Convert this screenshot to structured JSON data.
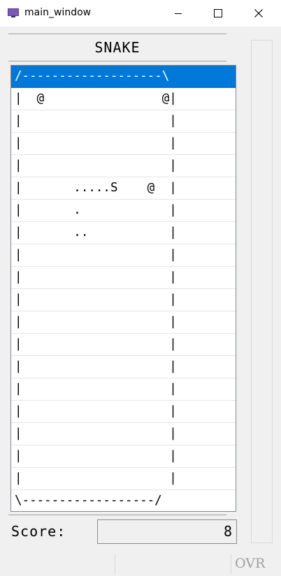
{
  "window": {
    "title": "main_window"
  },
  "game": {
    "title": "SNAKE",
    "board_rows": [
      "/-------------------\\",
      "|  @                @|",
      "|                    |",
      "|                    |",
      "|                    |",
      "|       .....S    @  |",
      "|       .            |",
      "|       ..           |",
      "|                    |",
      "|                    |",
      "|                    |",
      "|                    |",
      "|                    |",
      "|                    |",
      "|                    |",
      "|                    |",
      "|                    |",
      "|                    |",
      "|                    |",
      "\\------------------/"
    ],
    "score_label": "Score:",
    "score_value": "8"
  },
  "statusbar": {
    "mode": "OVR"
  },
  "colors": {
    "selection": "#0078d7",
    "background": "#f0f0f0"
  },
  "icons": {
    "app": "app-window-icon",
    "minimize": "minimize-icon",
    "maximize": "maximize-icon",
    "close": "close-icon"
  }
}
